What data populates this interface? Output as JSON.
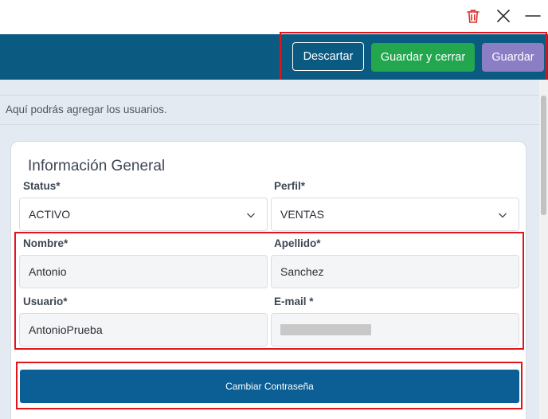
{
  "window": {
    "icons": [
      "trash-icon",
      "close-icon",
      "minimize-icon"
    ]
  },
  "toolbar": {
    "discard_label": "Descartar",
    "save_close_label": "Guardar y cerrar",
    "save_label": "Guardar"
  },
  "page": {
    "description": "Aquí podrás agregar los usuarios."
  },
  "form": {
    "title": "Información General",
    "status": {
      "label": "Status*",
      "value": "ACTIVO"
    },
    "profile": {
      "label": "Perfil*",
      "value": "VENTAS"
    },
    "first_name": {
      "label": "Nombre*",
      "value": "Antonio"
    },
    "last_name": {
      "label": "Apellido*",
      "value": "Sanchez"
    },
    "username": {
      "label": "Usuario*",
      "value": "AntonioPrueba"
    },
    "email": {
      "label": "E-mail *",
      "value": ""
    },
    "change_password_label": "Cambiar Contraseña"
  },
  "colors": {
    "header": "#0b5a82",
    "save_close": "#22a74e",
    "save": "#8b7ec4",
    "change_password": "#0b5f95",
    "highlight": "#e3141b",
    "trash_icon": "#d9302c"
  }
}
